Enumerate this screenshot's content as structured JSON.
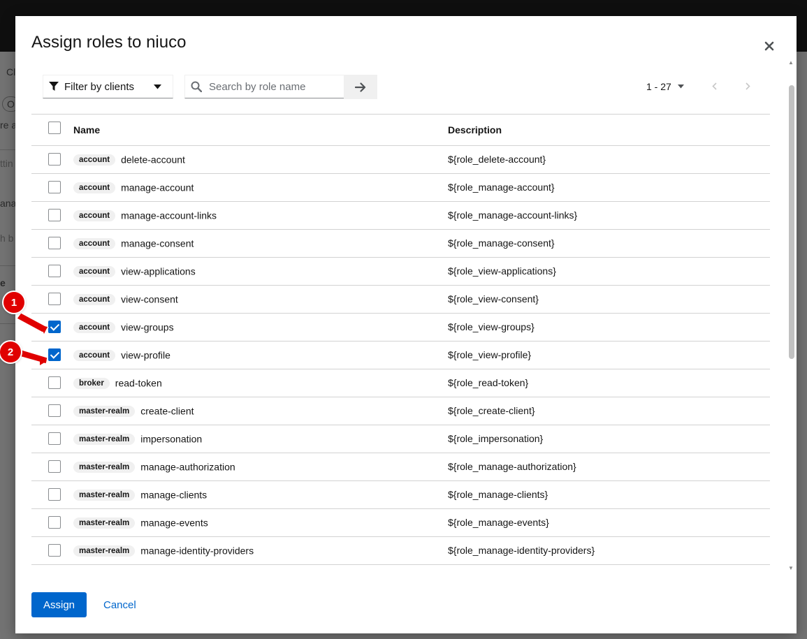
{
  "background": {
    "fragments": [
      "Cl",
      "O",
      "re a",
      "ttin",
      "ana",
      "h b",
      "e"
    ]
  },
  "modal": {
    "title": "Assign roles to niuco",
    "close_glyph": "×"
  },
  "toolbar": {
    "filter_label": "Filter by clients",
    "search_placeholder": "Search by role name",
    "pagination_range": "1 - 27"
  },
  "table": {
    "headers": {
      "name": "Name",
      "description": "Description"
    },
    "rows": [
      {
        "client": "account",
        "role": "delete-account",
        "description": "${role_delete-account}",
        "checked": false
      },
      {
        "client": "account",
        "role": "manage-account",
        "description": "${role_manage-account}",
        "checked": false
      },
      {
        "client": "account",
        "role": "manage-account-links",
        "description": "${role_manage-account-links}",
        "checked": false
      },
      {
        "client": "account",
        "role": "manage-consent",
        "description": "${role_manage-consent}",
        "checked": false
      },
      {
        "client": "account",
        "role": "view-applications",
        "description": "${role_view-applications}",
        "checked": false
      },
      {
        "client": "account",
        "role": "view-consent",
        "description": "${role_view-consent}",
        "checked": false
      },
      {
        "client": "account",
        "role": "view-groups",
        "description": "${role_view-groups}",
        "checked": true
      },
      {
        "client": "account",
        "role": "view-profile",
        "description": "${role_view-profile}",
        "checked": true
      },
      {
        "client": "broker",
        "role": "read-token",
        "description": "${role_read-token}",
        "checked": false
      },
      {
        "client": "master-realm",
        "role": "create-client",
        "description": "${role_create-client}",
        "checked": false
      },
      {
        "client": "master-realm",
        "role": "impersonation",
        "description": "${role_impersonation}",
        "checked": false
      },
      {
        "client": "master-realm",
        "role": "manage-authorization",
        "description": "${role_manage-authorization}",
        "checked": false
      },
      {
        "client": "master-realm",
        "role": "manage-clients",
        "description": "${role_manage-clients}",
        "checked": false
      },
      {
        "client": "master-realm",
        "role": "manage-events",
        "description": "${role_manage-events}",
        "checked": false
      },
      {
        "client": "master-realm",
        "role": "manage-identity-providers",
        "description": "${role_manage-identity-providers}",
        "checked": false
      }
    ]
  },
  "footer": {
    "assign_label": "Assign",
    "cancel_label": "Cancel"
  },
  "annotations": [
    {
      "label": "1"
    },
    {
      "label": "2"
    }
  ],
  "colors": {
    "primary": "#0066cc",
    "annotation": "#e00000",
    "badge_bg": "#f0f0f0"
  }
}
